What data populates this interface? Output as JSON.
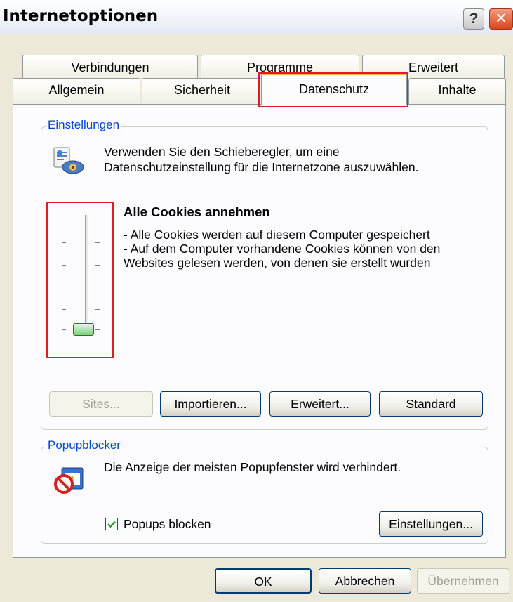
{
  "window": {
    "title": "Internetoptionen"
  },
  "titlebar": {
    "help": "?",
    "close": "✕"
  },
  "tabs": {
    "row1": [
      "Verbindungen",
      "Programme",
      "Erweitert"
    ],
    "row2": [
      "Allgemein",
      "Sicherheit",
      "Datenschutz",
      "Inhalte"
    ]
  },
  "settings": {
    "legend": "Einstellungen",
    "intro_line1": "Verwenden Sie den Schieberegler, um eine",
    "intro_line2": "Datenschutzeinstellung für die Internetzone auszuwählen.",
    "level_title": "Alle Cookies annehmen",
    "desc_line1": "- Alle Cookies werden auf diesem Computer gespeichert",
    "desc_line2": "- Auf dem Computer vorhandene Cookies können von den",
    "desc_line3": "Websites gelesen werden, von denen sie erstellt wurden",
    "slider_level": 0,
    "buttons": {
      "sites": "Sites...",
      "import": "Importieren...",
      "advanced": "Erweitert...",
      "default": "Standard"
    }
  },
  "popup": {
    "legend": "Popupblocker",
    "description": "Die Anzeige der meisten Popupfenster wird verhindert.",
    "checkbox_label": "Popups blocken",
    "checkbox_checked": true,
    "settings_button": "Einstellungen..."
  },
  "footer": {
    "ok": "OK",
    "cancel": "Abbrechen",
    "apply": "Übernehmen"
  },
  "colors": {
    "highlight": "#e11b22",
    "legend": "#0046d5",
    "dialog_bg": "#ece9d8"
  }
}
